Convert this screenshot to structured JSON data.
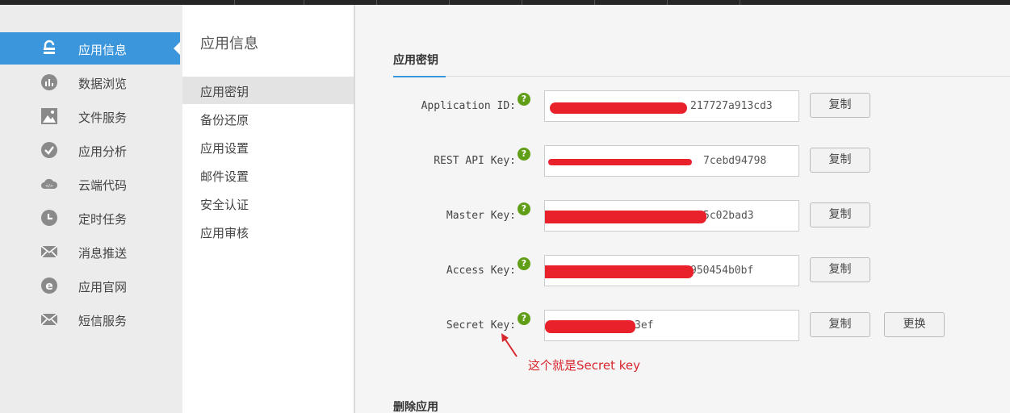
{
  "sidebar": {
    "items": [
      {
        "label": "应用信息",
        "icon": "lock-icon",
        "active": true
      },
      {
        "label": "数据浏览",
        "icon": "chart-icon"
      },
      {
        "label": "文件服务",
        "icon": "image-icon"
      },
      {
        "label": "应用分析",
        "icon": "check-circle-icon"
      },
      {
        "label": "云端代码",
        "icon": "cloud-icon"
      },
      {
        "label": "定时任务",
        "icon": "clock-icon"
      },
      {
        "label": "消息推送",
        "icon": "envelope-icon"
      },
      {
        "label": "应用官网",
        "icon": "ie-icon"
      },
      {
        "label": "短信服务",
        "icon": "envelope-icon"
      }
    ],
    "active_color": "#3b96dc"
  },
  "subnav": {
    "title": "应用信息",
    "items": [
      {
        "label": "应用密钥",
        "active": true
      },
      {
        "label": "备份还原"
      },
      {
        "label": "应用设置"
      },
      {
        "label": "邮件设置"
      },
      {
        "label": "安全认证"
      },
      {
        "label": "应用审核"
      }
    ]
  },
  "main": {
    "section_title": "应用密钥",
    "keys": [
      {
        "label": "Application ID:",
        "value_visible": "217727a913cd3",
        "copy_label": "复制"
      },
      {
        "label": "REST API Key:",
        "value_visible": "7cebd94798",
        "copy_label": "复制"
      },
      {
        "label": "Master Key:",
        "value_visible": "5c02bad3",
        "copy_label": "复制"
      },
      {
        "label": "Access Key:",
        "value_visible": "950454b0bf",
        "copy_label": "复制"
      },
      {
        "label": "Secret Key:",
        "value_visible": "3ef",
        "copy_label": "复制",
        "reset_label": "更换"
      }
    ],
    "help_icon": "?",
    "annotation": "这个就是Secret key",
    "delete_title": "删除应用"
  },
  "colors": {
    "help": "#5f9e16",
    "redaction": "#e8212b",
    "annotation": "#d8262e"
  }
}
